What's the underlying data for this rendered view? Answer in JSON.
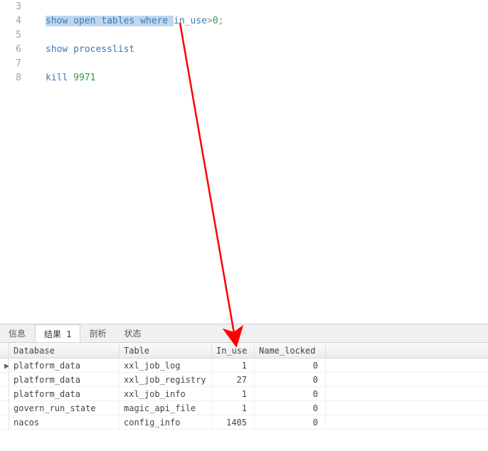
{
  "editor": {
    "lines": [
      {
        "n": 3,
        "segments": []
      },
      {
        "n": 4,
        "segments": [
          {
            "t": "show",
            "c": "kw sel"
          },
          {
            "t": " ",
            "c": "sel"
          },
          {
            "t": "open",
            "c": "kw sel"
          },
          {
            "t": " ",
            "c": "sel"
          },
          {
            "t": "tables",
            "c": "kw sel"
          },
          {
            "t": " ",
            "c": "sel"
          },
          {
            "t": "where",
            "c": "kw sel"
          },
          {
            "t": " ",
            "c": "sel"
          },
          {
            "t": "in_use",
            "c": "kw"
          },
          {
            "t": ">",
            "c": "op"
          },
          {
            "t": "0",
            "c": "num"
          },
          {
            "t": ";",
            "c": "op"
          }
        ]
      },
      {
        "n": 5,
        "segments": []
      },
      {
        "n": 6,
        "segments": [
          {
            "t": "show",
            "c": "kw"
          },
          {
            "t": " ",
            "c": ""
          },
          {
            "t": "processlist",
            "c": "kw"
          }
        ]
      },
      {
        "n": 7,
        "segments": []
      },
      {
        "n": 8,
        "segments": [
          {
            "t": "kill",
            "c": "kw"
          },
          {
            "t": " ",
            "c": ""
          },
          {
            "t": "9971",
            "c": "num"
          }
        ]
      }
    ]
  },
  "tabs": [
    {
      "label": "信息",
      "active": false
    },
    {
      "label": "结果 1",
      "active": true
    },
    {
      "label": "剖析",
      "active": false
    },
    {
      "label": "状态",
      "active": false
    }
  ],
  "grid": {
    "headers": [
      "Database",
      "Table",
      "In_use",
      "Name_locked"
    ],
    "rows": [
      {
        "marker": "▶",
        "db": "platform_data",
        "tbl": "xxl_job_log",
        "in_use": "1",
        "nl": "0"
      },
      {
        "marker": "",
        "db": "platform_data",
        "tbl": "xxl_job_registry",
        "in_use": "27",
        "nl": "0"
      },
      {
        "marker": "",
        "db": "platform_data",
        "tbl": "xxl_job_info",
        "in_use": "1",
        "nl": "0"
      },
      {
        "marker": "",
        "db": "govern_run_state",
        "tbl": "magic_api_file",
        "in_use": "1",
        "nl": "0"
      },
      {
        "marker": "",
        "db": "nacos",
        "tbl": "config_info",
        "in_use": "1405",
        "nl": "0"
      }
    ]
  }
}
